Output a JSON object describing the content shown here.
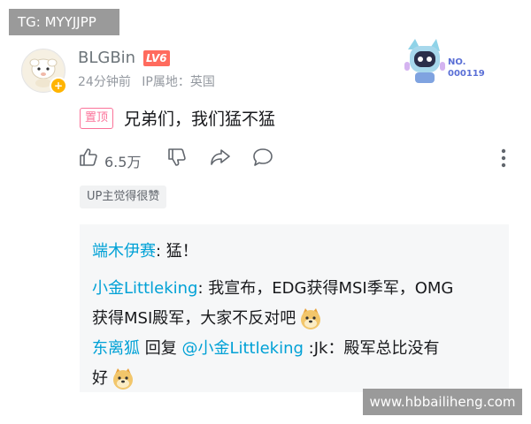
{
  "watermark_top": "TG: MYYJJPP",
  "watermark_bottom": "www.hbbailiheng.com",
  "comment": {
    "username": "BLGBin",
    "level": "LV6",
    "time": "24分钟前",
    "ip": "IP属地：英国",
    "pin_tag": "置顶",
    "text": "兄弟们，我们猛不猛",
    "like_count": "6.5万",
    "up_tag": "UP主觉得很赞",
    "decoration_no": "NO.",
    "decoration_id": "000119"
  },
  "replies": [
    {
      "name": "端木伊赛",
      "sep": ": ",
      "text": "猛！"
    },
    {
      "name": "小金Littleking",
      "sep": ": ",
      "text": "我宣布，EDG获得MSI季军，OMG",
      "text2": "获得MSI殿军，大家不反对吧"
    },
    {
      "name": "东离狐",
      "reply_word": " 回复 ",
      "mention": "@小金Littleking",
      "text": " :Jk：殿军总比没有",
      "text2": "好"
    }
  ],
  "colors": {
    "link_blue": "#00a1d6",
    "pin_pink": "#fb7299",
    "level_red": "#ff6b5e"
  }
}
